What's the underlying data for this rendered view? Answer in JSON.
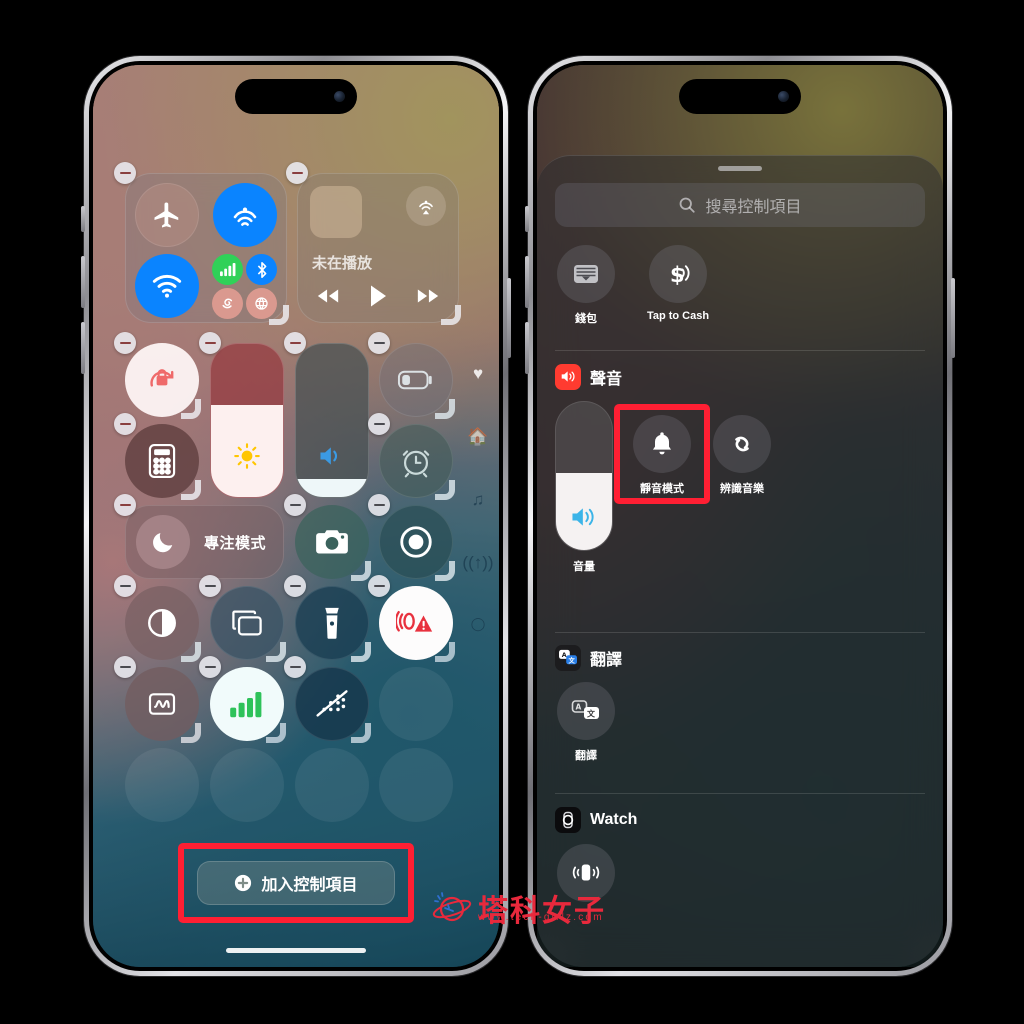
{
  "meta": {
    "watermark_text": "塔科女子",
    "watermark_url": "www.tech-girlz.com",
    "accent_red": "#ff1f33",
    "highlight_color": "#ff1f33"
  },
  "left_phone": {
    "screen_name": "control-center-edit-mode",
    "connectivity_module": {
      "tiles": [
        {
          "name": "airplane-mode",
          "state": "off"
        },
        {
          "name": "airdrop",
          "state": "on"
        },
        {
          "name": "wifi",
          "state": "on"
        },
        {
          "name": "cellular-data",
          "state": "on"
        },
        {
          "name": "bluetooth",
          "state": "on"
        },
        {
          "name": "personal-hotspot",
          "state": "off"
        },
        {
          "name": "vpn",
          "state": "off"
        }
      ]
    },
    "media_module": {
      "now_playing_label": "未在播放",
      "controls": [
        "rewind",
        "play",
        "fast-forward"
      ],
      "airplay_label": "airplay"
    },
    "controls": [
      {
        "name": "rotation-lock",
        "label": "",
        "state": "on"
      },
      {
        "name": "brightness-slider",
        "label": "",
        "value_percent": 60
      },
      {
        "name": "volume-slider",
        "label": "",
        "value_percent": 12
      },
      {
        "name": "low-power-mode",
        "label": "",
        "state": "off"
      },
      {
        "name": "calculator",
        "label": "",
        "state": "off"
      },
      {
        "name": "timer",
        "label": "",
        "state": "off"
      },
      {
        "name": "focus-mode",
        "label": "專注模式",
        "state": "off"
      },
      {
        "name": "camera",
        "label": "",
        "state": "off"
      },
      {
        "name": "screen-record",
        "label": "",
        "state": "off"
      },
      {
        "name": "dark-mode",
        "label": "",
        "state": "off"
      },
      {
        "name": "screen-mirroring",
        "label": "",
        "state": "off"
      },
      {
        "name": "flashlight",
        "label": "",
        "state": "off"
      },
      {
        "name": "crash-detection",
        "label": "",
        "state": "on"
      },
      {
        "name": "sound-recognition",
        "label": "",
        "state": "off"
      },
      {
        "name": "cellular-signal",
        "label": "",
        "state": "on"
      },
      {
        "name": "do-not-disturb-driving",
        "label": "",
        "state": "off"
      }
    ],
    "page_indicators": [
      "heart-icon",
      "home-icon",
      "music-note-icon",
      "connectivity-icon",
      "circle-icon"
    ],
    "add_control_button": {
      "label": "加入控制項目",
      "icon": "plus-circle-icon",
      "highlighted": true
    }
  },
  "right_phone": {
    "screen_name": "add-control-gallery",
    "search": {
      "placeholder": "搜尋控制項目",
      "value": "",
      "icon": "search-icon"
    },
    "sections": [
      {
        "header": "",
        "header_icon": "",
        "items": [
          {
            "name": "wallet",
            "label": "錢包",
            "icon": "wallet-icon"
          },
          {
            "name": "tap-to-cash",
            "label": "Tap to Cash",
            "icon": "dollar-contactless-icon"
          }
        ]
      },
      {
        "header": "聲音",
        "header_icon": "speaker-icon",
        "header_icon_color": "#ff3b30",
        "items": [
          {
            "name": "volume",
            "label": "音量",
            "icon": "volume-slider-icon",
            "type": "slider",
            "value_percent": 52
          },
          {
            "name": "silent-mode",
            "label": "靜音模式",
            "icon": "bell-icon",
            "highlighted": true
          },
          {
            "name": "recognize-music",
            "label": "辨識音樂",
            "icon": "shazam-icon"
          }
        ]
      },
      {
        "header": "翻譯",
        "header_icon": "translate-app-icon",
        "items": [
          {
            "name": "translate",
            "label": "翻譯",
            "icon": "translate-bubbles-icon"
          }
        ]
      },
      {
        "header": "Watch",
        "header_icon": "watch-app-icon",
        "items": [
          {
            "name": "ping-watch",
            "label": "",
            "icon": "ping-watch-icon"
          }
        ]
      }
    ]
  }
}
